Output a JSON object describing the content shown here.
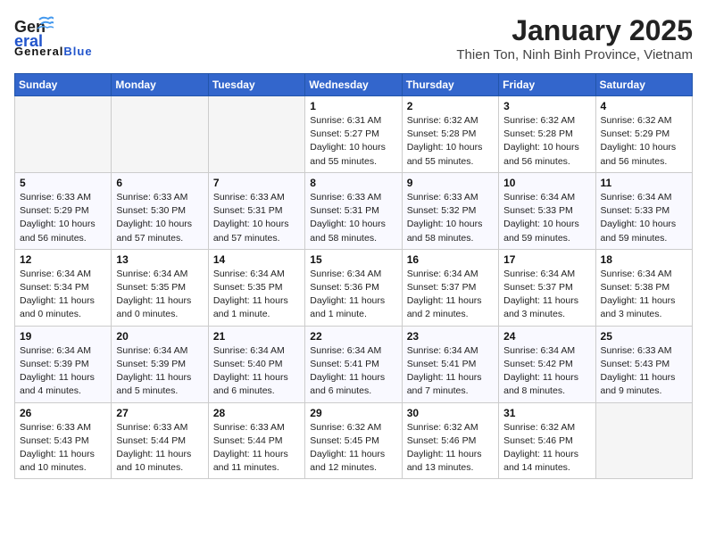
{
  "header": {
    "logo_line1": "General",
    "logo_line2": "Blue",
    "title": "January 2025",
    "subtitle": "Thien Ton, Ninh Binh Province, Vietnam"
  },
  "days_of_week": [
    "Sunday",
    "Monday",
    "Tuesday",
    "Wednesday",
    "Thursday",
    "Friday",
    "Saturday"
  ],
  "weeks": [
    [
      {
        "day": "",
        "info": ""
      },
      {
        "day": "",
        "info": ""
      },
      {
        "day": "",
        "info": ""
      },
      {
        "day": "1",
        "info": "Sunrise: 6:31 AM\nSunset: 5:27 PM\nDaylight: 10 hours\nand 55 minutes."
      },
      {
        "day": "2",
        "info": "Sunrise: 6:32 AM\nSunset: 5:28 PM\nDaylight: 10 hours\nand 55 minutes."
      },
      {
        "day": "3",
        "info": "Sunrise: 6:32 AM\nSunset: 5:28 PM\nDaylight: 10 hours\nand 56 minutes."
      },
      {
        "day": "4",
        "info": "Sunrise: 6:32 AM\nSunset: 5:29 PM\nDaylight: 10 hours\nand 56 minutes."
      }
    ],
    [
      {
        "day": "5",
        "info": "Sunrise: 6:33 AM\nSunset: 5:29 PM\nDaylight: 10 hours\nand 56 minutes."
      },
      {
        "day": "6",
        "info": "Sunrise: 6:33 AM\nSunset: 5:30 PM\nDaylight: 10 hours\nand 57 minutes."
      },
      {
        "day": "7",
        "info": "Sunrise: 6:33 AM\nSunset: 5:31 PM\nDaylight: 10 hours\nand 57 minutes."
      },
      {
        "day": "8",
        "info": "Sunrise: 6:33 AM\nSunset: 5:31 PM\nDaylight: 10 hours\nand 58 minutes."
      },
      {
        "day": "9",
        "info": "Sunrise: 6:33 AM\nSunset: 5:32 PM\nDaylight: 10 hours\nand 58 minutes."
      },
      {
        "day": "10",
        "info": "Sunrise: 6:34 AM\nSunset: 5:33 PM\nDaylight: 10 hours\nand 59 minutes."
      },
      {
        "day": "11",
        "info": "Sunrise: 6:34 AM\nSunset: 5:33 PM\nDaylight: 10 hours\nand 59 minutes."
      }
    ],
    [
      {
        "day": "12",
        "info": "Sunrise: 6:34 AM\nSunset: 5:34 PM\nDaylight: 11 hours\nand 0 minutes."
      },
      {
        "day": "13",
        "info": "Sunrise: 6:34 AM\nSunset: 5:35 PM\nDaylight: 11 hours\nand 0 minutes."
      },
      {
        "day": "14",
        "info": "Sunrise: 6:34 AM\nSunset: 5:35 PM\nDaylight: 11 hours\nand 1 minute."
      },
      {
        "day": "15",
        "info": "Sunrise: 6:34 AM\nSunset: 5:36 PM\nDaylight: 11 hours\nand 1 minute."
      },
      {
        "day": "16",
        "info": "Sunrise: 6:34 AM\nSunset: 5:37 PM\nDaylight: 11 hours\nand 2 minutes."
      },
      {
        "day": "17",
        "info": "Sunrise: 6:34 AM\nSunset: 5:37 PM\nDaylight: 11 hours\nand 3 minutes."
      },
      {
        "day": "18",
        "info": "Sunrise: 6:34 AM\nSunset: 5:38 PM\nDaylight: 11 hours\nand 3 minutes."
      }
    ],
    [
      {
        "day": "19",
        "info": "Sunrise: 6:34 AM\nSunset: 5:39 PM\nDaylight: 11 hours\nand 4 minutes."
      },
      {
        "day": "20",
        "info": "Sunrise: 6:34 AM\nSunset: 5:39 PM\nDaylight: 11 hours\nand 5 minutes."
      },
      {
        "day": "21",
        "info": "Sunrise: 6:34 AM\nSunset: 5:40 PM\nDaylight: 11 hours\nand 6 minutes."
      },
      {
        "day": "22",
        "info": "Sunrise: 6:34 AM\nSunset: 5:41 PM\nDaylight: 11 hours\nand 6 minutes."
      },
      {
        "day": "23",
        "info": "Sunrise: 6:34 AM\nSunset: 5:41 PM\nDaylight: 11 hours\nand 7 minutes."
      },
      {
        "day": "24",
        "info": "Sunrise: 6:34 AM\nSunset: 5:42 PM\nDaylight: 11 hours\nand 8 minutes."
      },
      {
        "day": "25",
        "info": "Sunrise: 6:33 AM\nSunset: 5:43 PM\nDaylight: 11 hours\nand 9 minutes."
      }
    ],
    [
      {
        "day": "26",
        "info": "Sunrise: 6:33 AM\nSunset: 5:43 PM\nDaylight: 11 hours\nand 10 minutes."
      },
      {
        "day": "27",
        "info": "Sunrise: 6:33 AM\nSunset: 5:44 PM\nDaylight: 11 hours\nand 10 minutes."
      },
      {
        "day": "28",
        "info": "Sunrise: 6:33 AM\nSunset: 5:44 PM\nDaylight: 11 hours\nand 11 minutes."
      },
      {
        "day": "29",
        "info": "Sunrise: 6:32 AM\nSunset: 5:45 PM\nDaylight: 11 hours\nand 12 minutes."
      },
      {
        "day": "30",
        "info": "Sunrise: 6:32 AM\nSunset: 5:46 PM\nDaylight: 11 hours\nand 13 minutes."
      },
      {
        "day": "31",
        "info": "Sunrise: 6:32 AM\nSunset: 5:46 PM\nDaylight: 11 hours\nand 14 minutes."
      },
      {
        "day": "",
        "info": ""
      }
    ]
  ]
}
